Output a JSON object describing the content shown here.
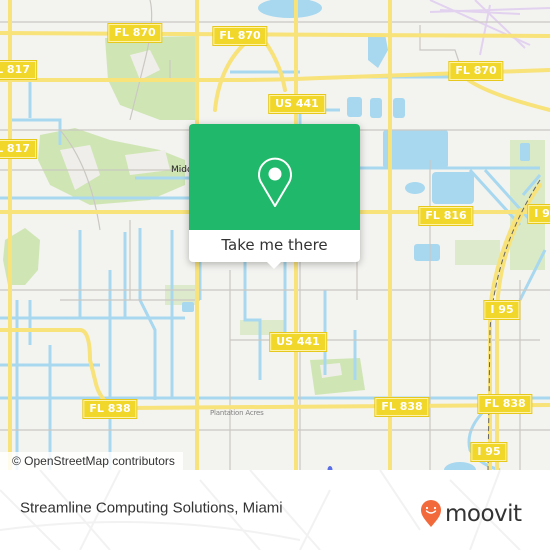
{
  "map": {
    "colors": {
      "land": "#f3f3f0",
      "water": "#a7d8ef",
      "park": "#cfe6b4",
      "road_major": "#f8e27a",
      "road_minor": "#c9c6c0",
      "shield": "#f1d72a",
      "airport": "#e7d9f2"
    },
    "road_shields": [
      {
        "id": "fl870-a",
        "label": "FL 870"
      },
      {
        "id": "fl870-b",
        "label": "FL 870"
      },
      {
        "id": "fl870-c",
        "label": "FL 870"
      },
      {
        "id": "fl817-a",
        "label": "L 817"
      },
      {
        "id": "fl817-b",
        "label": "L 817"
      },
      {
        "id": "us441-a",
        "label": "US 441"
      },
      {
        "id": "us441-b",
        "label": "US 441"
      },
      {
        "id": "fl816",
        "label": "FL 816"
      },
      {
        "id": "i95-a",
        "label": "I 9"
      },
      {
        "id": "i95-b",
        "label": "I 95"
      },
      {
        "id": "i95-c",
        "label": "I 95"
      },
      {
        "id": "fl838-a",
        "label": "FL 838"
      },
      {
        "id": "fl838-b",
        "label": "FL 838"
      },
      {
        "id": "fl838-c",
        "label": "FL 838"
      }
    ],
    "place_labels": [
      {
        "id": "middle-river",
        "label": "Midd"
      },
      {
        "id": "faint-town",
        "label": "Plantation Acres"
      }
    ],
    "attribution": "© OpenStreetMap contributors"
  },
  "popup": {
    "icon": "location-pin-icon",
    "button_label": "Take me there",
    "color": "#20b86a"
  },
  "footer": {
    "title": "Streamline Computing Solutions, Miami",
    "brand": "moovit",
    "brand_color": "#f26a3c"
  }
}
